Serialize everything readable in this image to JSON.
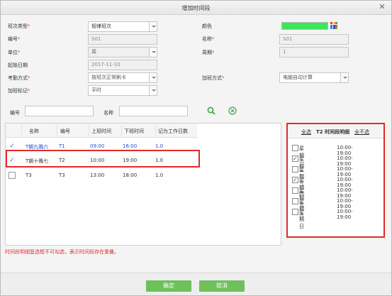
{
  "window": {
    "title": "增加时间段"
  },
  "form": {
    "shift_type": {
      "label": "班次类型",
      "value": "规律班次"
    },
    "color": {
      "label": "颜色",
      "value": "#3de65a"
    },
    "code": {
      "label": "编号",
      "value": "S01"
    },
    "name": {
      "label": "名称",
      "value": "S01"
    },
    "unit": {
      "label": "单位",
      "value": "周"
    },
    "period": {
      "label": "周期",
      "value": "1"
    },
    "start_date": {
      "label": "起始日期",
      "value": "2017-11-10"
    },
    "attendance": {
      "label": "考勤方式",
      "value": "按班次正常刷卡"
    },
    "overtime_mode": {
      "label": "加班方式",
      "value": "电脑自动计算"
    },
    "overtime_flag": {
      "label": "加班标记",
      "value": "平时"
    }
  },
  "search": {
    "code_label": "编号",
    "name_label": "名称",
    "code_value": "",
    "name_value": "",
    "search_icon": "search-icon",
    "clear_icon": "clear-icon"
  },
  "table": {
    "headers": [
      "名称",
      "编号",
      "上班时间",
      "下班时间",
      "记为工作日数"
    ],
    "rows": [
      {
        "checked": true,
        "name": "T朝九晚六",
        "code": "T1",
        "start": "09:00",
        "end": "16:00",
        "days": "1.0",
        "color": "#1f4fd1"
      },
      {
        "checked": true,
        "name": "T朝十晚七",
        "code": "T2",
        "start": "10:00",
        "end": "19:00",
        "days": "1.0",
        "color": "#333333"
      },
      {
        "checked": false,
        "name": "T3",
        "code": "T3",
        "start": "13:00",
        "end": "18:00",
        "days": "1.0",
        "color": "#333333"
      }
    ]
  },
  "detail": {
    "select_all": "全选",
    "title": "T2 时间段明细",
    "select_none": "全不选",
    "days": [
      {
        "name": "星期一",
        "time": "10:00-19:00",
        "checked": false
      },
      {
        "name": "星期二",
        "time": "10:00-19:00",
        "checked": true
      },
      {
        "name": "星期三",
        "time": "10:00-19:00",
        "checked": false
      },
      {
        "name": "星期四",
        "time": "10:00-19:00",
        "checked": true
      },
      {
        "name": "星期五",
        "time": "10:00-19:00",
        "checked": false
      },
      {
        "name": "星期六",
        "time": "10:00-19:00",
        "checked": false
      },
      {
        "name": "星期日",
        "time": "10:00-19:00",
        "checked": false
      }
    ]
  },
  "note": "时间段明细复选框不可勾选，表示时间段存在重叠。",
  "buttons": {
    "ok": "确定",
    "cancel": "取消"
  }
}
